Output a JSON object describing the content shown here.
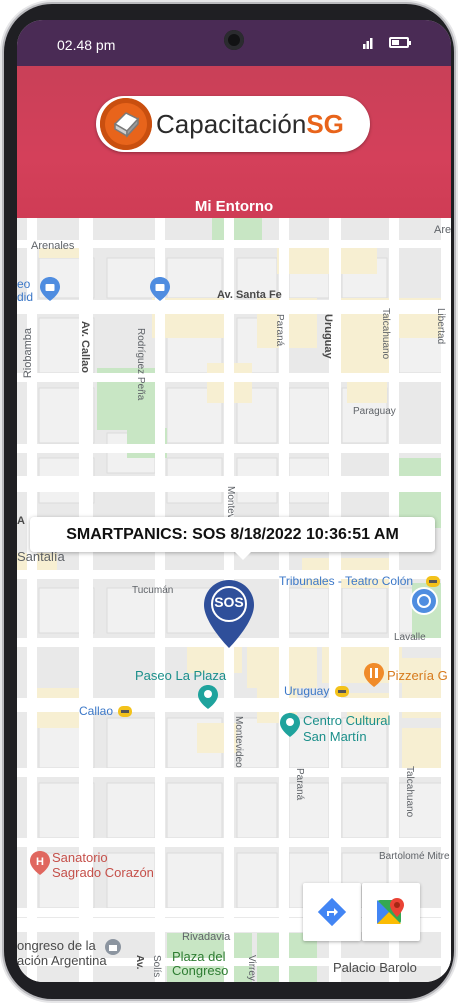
{
  "status_bar": {
    "time": "02.48 pm"
  },
  "header": {
    "logo_text_main": "Capacitación",
    "logo_text_accent": "SG",
    "screen_title": "Mi Entorno"
  },
  "map": {
    "streets": {
      "arenales": "Arenales",
      "av_santa_fe": "Av. Santa Fe",
      "riobamba": "Riobamba",
      "av_callao": "Av. Callao",
      "rodriguez_pena": "Rodríguez Peña",
      "parana_top": "Paraná",
      "uruguay": "Uruguay",
      "talcahuano_top": "Talcahuano",
      "libertad": "Libertad",
      "paraguay": "Paraguay",
      "montevideo_top": "Montevideo",
      "tucuman": "Tucumán",
      "lavalle": "Lavalle",
      "montevideo_bottom": "Montevideo",
      "parana_bottom": "Paraná",
      "talcahuano_bottom": "Talcahuano",
      "bartolome_mitre": "Bartolomé Mitre",
      "rivadavia": "Rivadavia",
      "av_partial": "Av.",
      "solis": "Solís",
      "virrey": "Virrey"
    },
    "places": {
      "left_top": "eo\ndid",
      "santalia_a": "A",
      "santalia": "Santalía",
      "tribunales": "Tribunales - Teatro Colón",
      "paseo_la_plaza": "Paseo La Plaza",
      "pizzeria": "Pizzería G",
      "uruguay_station": "Uruguay",
      "callao_station": "Callao",
      "centro_cultural_1": "Centro Cultural",
      "centro_cultural_2": "San Martín",
      "sanatorio_1": "Sanatorio",
      "sanatorio_2": "Sagrado Corazón",
      "congreso_1": "ongreso de la",
      "congreso_2": "ación Argentina",
      "plaza_congreso_1": "Plaza del",
      "plaza_congreso_2": "Congreso",
      "palacio_barolo": "Palacio Barolo"
    },
    "alert_callout": "SMARTPANICS: SOS 8/18/2022 10:36:51 AM",
    "sos_marker_label": "SOS"
  },
  "colors": {
    "header_accent": "#d4405a",
    "status_bar": "#4a2b55",
    "logo_orange": "#e8641b",
    "sos_marker": "#2f4f9a"
  },
  "icons": {
    "directions": "directions-icon",
    "google_maps": "google-maps-icon"
  }
}
